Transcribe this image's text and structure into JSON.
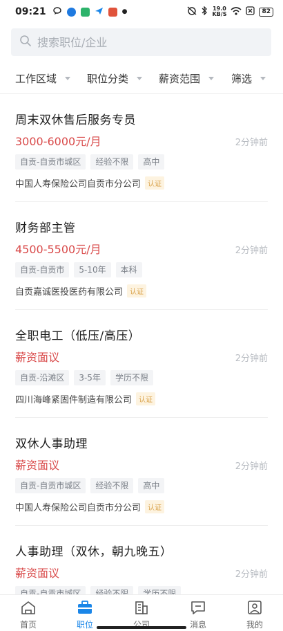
{
  "status_bar": {
    "time": "09:21",
    "net_speed_value": "19.0",
    "net_speed_unit": "KB/S",
    "battery": "82"
  },
  "search": {
    "placeholder": "搜索职位/企业"
  },
  "filters": [
    "工作区域",
    "职位分类",
    "薪资范围",
    "筛选"
  ],
  "jobs": [
    {
      "title": "周末双休售后服务专员",
      "salary": "3000-6000元/月",
      "time": "2分钟前",
      "tags": [
        "自贡-自贡市城区",
        "经验不限",
        "高中"
      ],
      "company": "中国人寿保险公司自贡市分公司",
      "verified": "认证"
    },
    {
      "title": "财务部主管",
      "salary": "4500-5500元/月",
      "time": "2分钟前",
      "tags": [
        "自贡-自贡市",
        "5-10年",
        "本科"
      ],
      "company": "自贡嘉诚医投医药有限公司",
      "verified": "认证"
    },
    {
      "title": "全职电工（低压/高压）",
      "salary": "薪资面议",
      "time": "2分钟前",
      "tags": [
        "自贡-沿滩区",
        "3-5年",
        "学历不限"
      ],
      "company": "四川海峰紧固件制造有限公司",
      "verified": "认证"
    },
    {
      "title": "双休人事助理",
      "salary": "薪资面议",
      "time": "2分钟前",
      "tags": [
        "自贡-自贡市城区",
        "经验不限",
        "高中"
      ],
      "company": "中国人寿保险公司自贡市分公司",
      "verified": "认证"
    },
    {
      "title": "人事助理（双休，朝九晚五）",
      "salary": "薪资面议",
      "time": "2分钟前",
      "tags": [
        "自贡-自贡市城区",
        "经验不限",
        "学历不限"
      ],
      "company": "",
      "verified": ""
    }
  ],
  "tabbar": {
    "items": [
      {
        "label": "首页",
        "icon": "home-icon"
      },
      {
        "label": "职位",
        "icon": "briefcase-icon"
      },
      {
        "label": "公司",
        "icon": "building-icon"
      },
      {
        "label": "消息",
        "icon": "message-icon"
      },
      {
        "label": "我的",
        "icon": "profile-icon"
      }
    ],
    "active_color": "#1a86e8"
  },
  "colors": {
    "salary": "#d94a4a",
    "accent": "#1a86e8"
  }
}
